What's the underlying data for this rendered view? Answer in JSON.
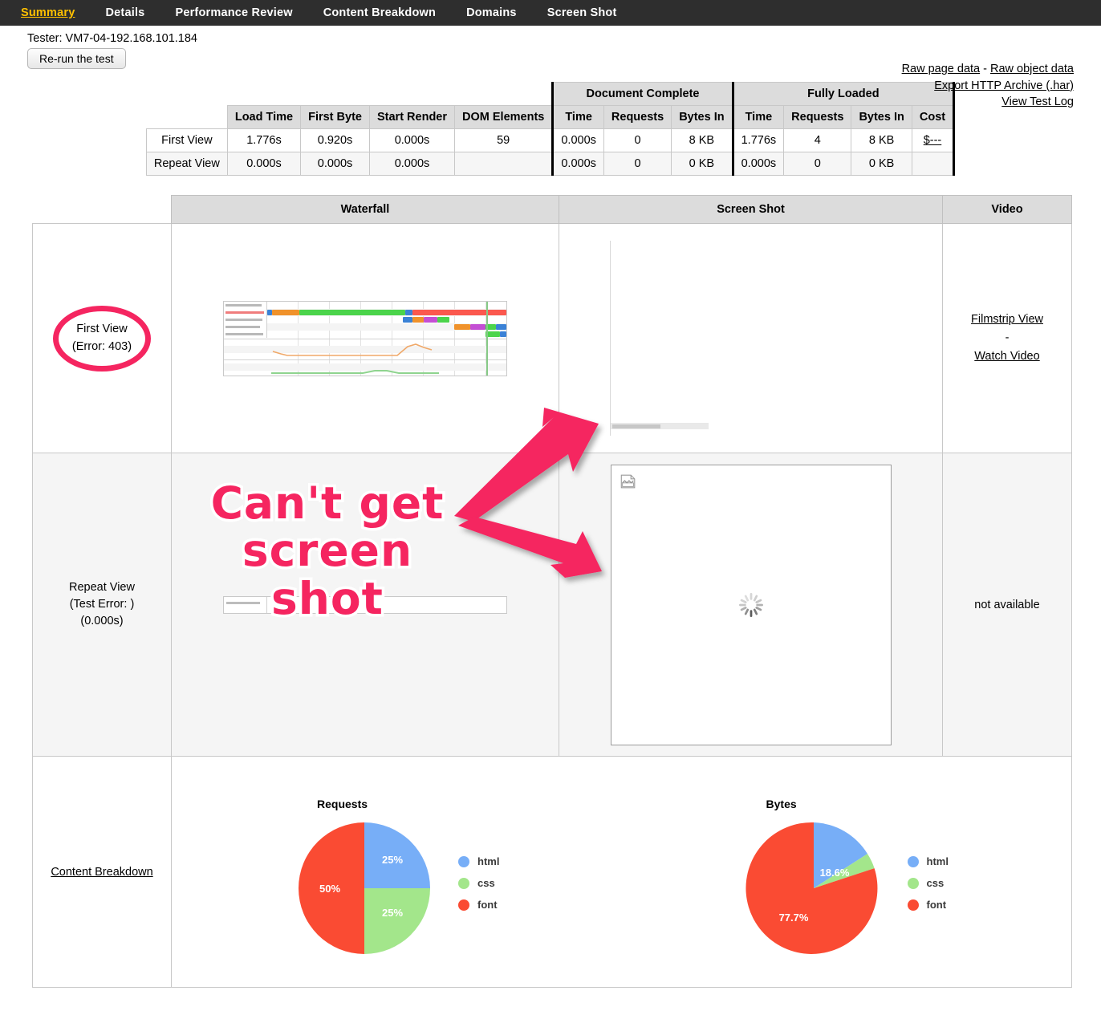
{
  "nav": {
    "items": [
      {
        "label": "Summary",
        "active": true
      },
      {
        "label": "Details",
        "active": false
      },
      {
        "label": "Performance Review",
        "active": false
      },
      {
        "label": "Content Breakdown",
        "active": false
      },
      {
        "label": "Domains",
        "active": false
      },
      {
        "label": "Screen Shot",
        "active": false
      }
    ]
  },
  "header": {
    "tester": "Tester: VM7-04-192.168.101.184",
    "rerun_label": "Re-run the test",
    "links": {
      "raw_page_data": "Raw page data",
      "separator": " - ",
      "raw_object_data": "Raw object data",
      "export_har": "Export HTTP Archive (.har)",
      "view_test_log": "View Test Log"
    }
  },
  "metrics": {
    "group_headers": [
      "Document Complete",
      "Fully Loaded"
    ],
    "columns": [
      "Load Time",
      "First Byte",
      "Start Render",
      "DOM Elements",
      "Time",
      "Requests",
      "Bytes In",
      "Time",
      "Requests",
      "Bytes In",
      "Cost"
    ],
    "rows": [
      {
        "label": "First View",
        "load_time": "1.776s",
        "first_byte": "0.920s",
        "start_render": "0.000s",
        "dom_elements": "59",
        "dc_time": "0.000s",
        "dc_requests": "0",
        "dc_bytes": "8 KB",
        "fl_time": "1.776s",
        "fl_requests": "4",
        "fl_bytes": "8 KB",
        "cost": "$---"
      },
      {
        "label": "Repeat View",
        "load_time": "0.000s",
        "first_byte": "0.000s",
        "start_render": "0.000s",
        "dom_elements": "",
        "dc_time": "0.000s",
        "dc_requests": "0",
        "dc_bytes": "0 KB",
        "fl_time": "0.000s",
        "fl_requests": "0",
        "fl_bytes": "0 KB",
        "cost": ""
      }
    ]
  },
  "results": {
    "headers": {
      "corner": "",
      "waterfall": "Waterfall",
      "screenshot": "Screen Shot",
      "video": "Video"
    },
    "first_view": {
      "label_line1": "First View",
      "label_line2": "(Error: 403)",
      "video_filmstrip": "Filmstrip View",
      "video_dash": "-",
      "video_watch": "Watch Video"
    },
    "repeat_view": {
      "label_line1": "Repeat View",
      "label_line2": "(Test Error: )",
      "label_line3": "(0.000s)",
      "video_status": "not available"
    },
    "content_row": {
      "label": "Content Breakdown"
    }
  },
  "annotation": {
    "line1": "Can't get",
    "line2": "screen shot",
    "color": "#f52560"
  },
  "chart_data": [
    {
      "type": "pie",
      "title": "Requests",
      "categories": [
        "html",
        "css",
        "font"
      ],
      "values": [
        25,
        25,
        50
      ],
      "labels": [
        "25%",
        "25%",
        "50%"
      ],
      "colors": [
        "#77aef7",
        "#a3e68b",
        "#fa4b33"
      ],
      "legend_position": "right"
    },
    {
      "type": "pie",
      "title": "Bytes",
      "categories": [
        "html",
        "css",
        "font"
      ],
      "values": [
        18.6,
        3.7,
        77.7
      ],
      "labels": [
        "18.6%",
        "",
        "77.7%"
      ],
      "colors": [
        "#77aef7",
        "#a3e68b",
        "#fa4b33"
      ],
      "legend_position": "right"
    }
  ]
}
